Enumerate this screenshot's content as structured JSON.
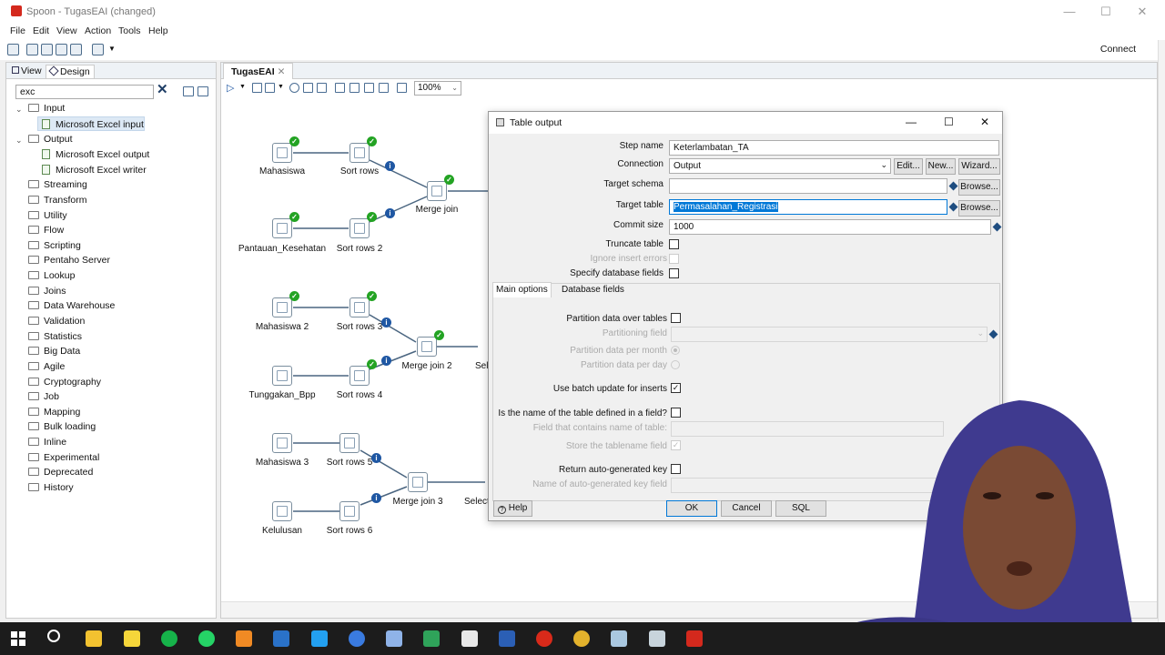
{
  "window": {
    "title": "Spoon - TugasEAI (changed)"
  },
  "menu": [
    "File",
    "Edit",
    "View",
    "Action",
    "Tools",
    "Help"
  ],
  "toolbar": {
    "connect": "Connect"
  },
  "left_panel": {
    "tabs": [
      "View",
      "Design"
    ],
    "search_value": "exc",
    "tree": [
      {
        "label": "Input",
        "type": "folder",
        "expanded": true
      },
      {
        "label": "Microsoft Excel input",
        "type": "step",
        "selected": true
      },
      {
        "label": "Output",
        "type": "folder",
        "expanded": true
      },
      {
        "label": "Microsoft Excel output",
        "type": "step"
      },
      {
        "label": "Microsoft Excel writer",
        "type": "step"
      },
      {
        "label": "Streaming",
        "type": "folder"
      },
      {
        "label": "Transform",
        "type": "folder"
      },
      {
        "label": "Utility",
        "type": "folder"
      },
      {
        "label": "Flow",
        "type": "folder"
      },
      {
        "label": "Scripting",
        "type": "folder"
      },
      {
        "label": "Pentaho Server",
        "type": "folder"
      },
      {
        "label": "Lookup",
        "type": "folder"
      },
      {
        "label": "Joins",
        "type": "folder"
      },
      {
        "label": "Data Warehouse",
        "type": "folder"
      },
      {
        "label": "Validation",
        "type": "folder"
      },
      {
        "label": "Statistics",
        "type": "folder"
      },
      {
        "label": "Big Data",
        "type": "folder"
      },
      {
        "label": "Agile",
        "type": "folder"
      },
      {
        "label": "Cryptography",
        "type": "folder"
      },
      {
        "label": "Job",
        "type": "folder"
      },
      {
        "label": "Mapping",
        "type": "folder"
      },
      {
        "label": "Bulk loading",
        "type": "folder"
      },
      {
        "label": "Inline",
        "type": "folder"
      },
      {
        "label": "Experimental",
        "type": "folder"
      },
      {
        "label": "Deprecated",
        "type": "folder"
      },
      {
        "label": "History",
        "type": "folder"
      }
    ]
  },
  "canvas": {
    "tab": "TugasEAI",
    "zoom": "100%",
    "nodes": {
      "mahasiswa": "Mahasiswa",
      "sort_rows": "Sort rows",
      "merge_join": "Merge join",
      "pantauan": "Pantauan_Kesehatan",
      "sort_rows_2": "Sort rows 2",
      "mahasiswa_2": "Mahasiswa 2",
      "sort_rows_3": "Sort rows 3",
      "merge_join_2": "Merge join 2",
      "sel_1": "Sel",
      "tunggakan": "Tunggakan_Bpp",
      "sort_rows_4": "Sort rows 4",
      "mahasiswa_3": "Mahasiswa 3",
      "sort_rows_5": "Sort rows 5",
      "merge_join_3": "Merge join 3",
      "select_2": "Select",
      "kelulusan": "Kelulusan",
      "sort_rows_6": "Sort rows 6"
    }
  },
  "dialog": {
    "title": "Table output",
    "step_name_label": "Step name",
    "step_name": "Keterlambatan_TA",
    "connection_label": "Connection",
    "connection": "Output",
    "edit": "Edit...",
    "new": "New...",
    "wizard": "Wizard...",
    "target_schema_label": "Target schema",
    "browse": "Browse...",
    "target_table_label": "Target table",
    "target_table": "Permasalahan_Registrasi",
    "commit_size_label": "Commit size",
    "commit_size": "1000",
    "truncate_label": "Truncate table",
    "ignore_label": "Ignore insert errors",
    "specify_label": "Specify database fields",
    "tabs": [
      "Main options",
      "Database fields"
    ],
    "partition_label": "Partition data over tables",
    "partition_field_label": "Partitioning field",
    "per_month_label": "Partition data per month",
    "per_day_label": "Partition data per day",
    "batch_label": "Use batch update for inserts",
    "name_in_field_label": "Is the name of the table defined in a field?",
    "field_name_label": "Field that contains name of table:",
    "store_label": "Store the tablename field",
    "return_key_label": "Return auto-generated key",
    "key_field_label": "Name of auto-generated key field",
    "help": "Help",
    "ok": "OK",
    "cancel": "Cancel",
    "sql": "SQL"
  },
  "colors": {
    "accent": "#1e4d80",
    "check": "#23a323",
    "selection": "#0078d7",
    "taskbar": "#1c1c1c"
  }
}
